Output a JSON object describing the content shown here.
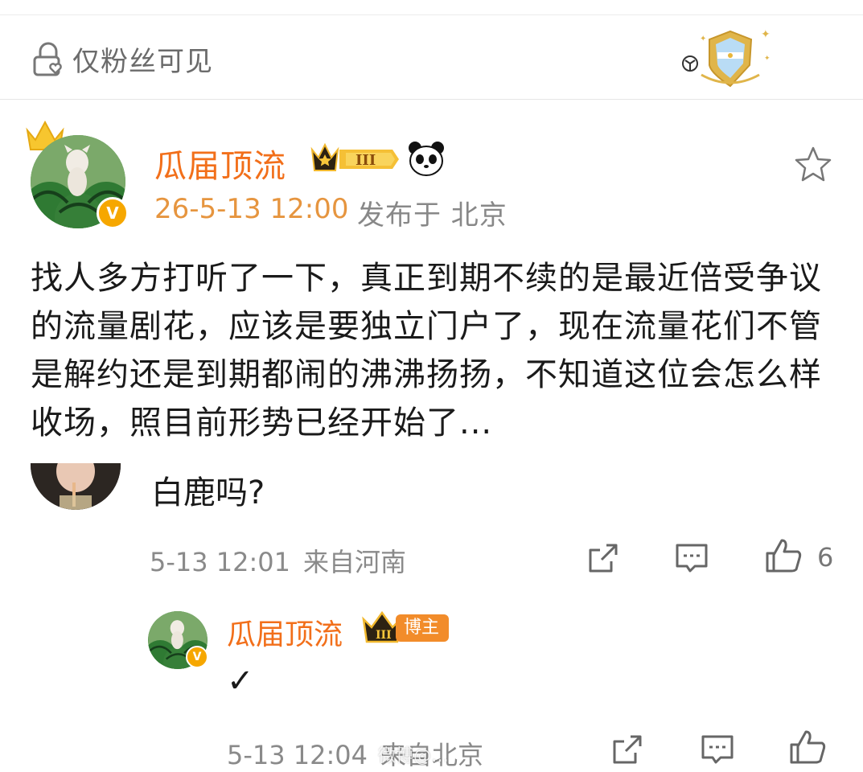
{
  "visibility": {
    "label": "仅粉丝可见"
  },
  "post": {
    "author": "瓜届顶流",
    "level_badge": "III",
    "date": "26-5-13 12:00",
    "location": "发布于 北京",
    "body": "找人多方打听了一下，真正到期不续的是最近倍受争议的流量剧花，应该是要独立门户了，现在流量花们不管是解约还是到期都闹的沸沸扬扬，不知道这位会怎么样收场，照目前形势已经开始了..."
  },
  "comment": {
    "text": "白鹿吗?",
    "date": "5-13 12:01",
    "location": "来自河南",
    "like_count": "6"
  },
  "reply": {
    "author": "瓜届顶流",
    "level_badge": "III",
    "role_badge": "博主",
    "text": "✓",
    "date": "5-13 12:04",
    "location": "来自北京"
  },
  "watermark": "微博@…",
  "icons": {
    "lock": "lock-heart-icon",
    "fan_badge": "fan-shield-badge-icon",
    "crown": "crown-icon",
    "panda": "panda-icon",
    "star": "star-icon",
    "share": "share-icon",
    "comment": "comment-icon",
    "like": "thumbs-up-icon"
  },
  "colors": {
    "accent_name": "#f26f1a",
    "date_orange": "#e6953f",
    "gray_text": "#888888",
    "badge_orange": "#f28c2a",
    "verify_yellow": "#f6a700"
  }
}
